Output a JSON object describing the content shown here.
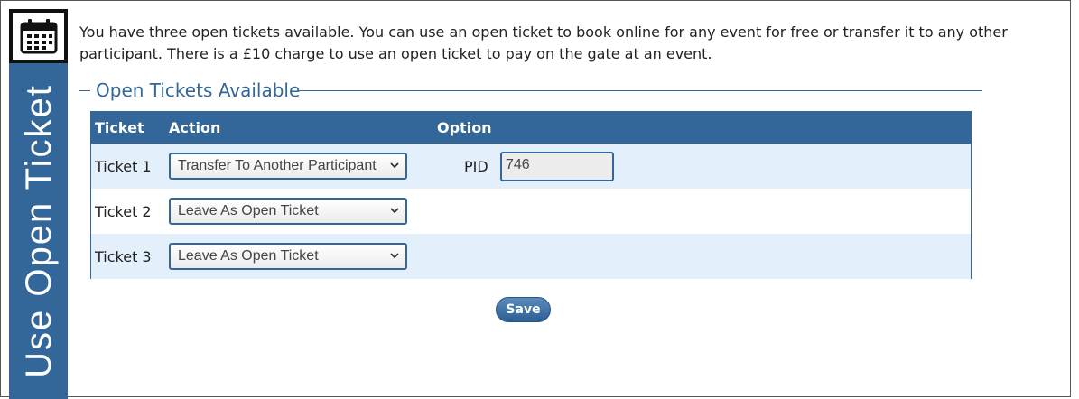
{
  "sidebar": {
    "title": "Use Open Ticket",
    "icon": "calendar-icon"
  },
  "intro_text": "You have three open tickets available. You can use an open ticket to book online for any event for free or transfer it to any other participant. There is a £10 charge to use an open ticket to pay on the gate at an event.",
  "section": {
    "legend": "Open Tickets Available"
  },
  "table": {
    "headers": [
      "Ticket",
      "Action",
      "Option"
    ],
    "rows": [
      {
        "ticket": "Ticket 1",
        "action": "Transfer To Another Participant",
        "option_label": "PID",
        "option_value": "746"
      },
      {
        "ticket": "Ticket 2",
        "action": "Leave As Open Ticket"
      },
      {
        "ticket": "Ticket 3",
        "action": "Leave As Open Ticket"
      }
    ]
  },
  "save_label": "Save",
  "colors": {
    "accent": "#336699",
    "row_alt": "#e3f0fb"
  }
}
